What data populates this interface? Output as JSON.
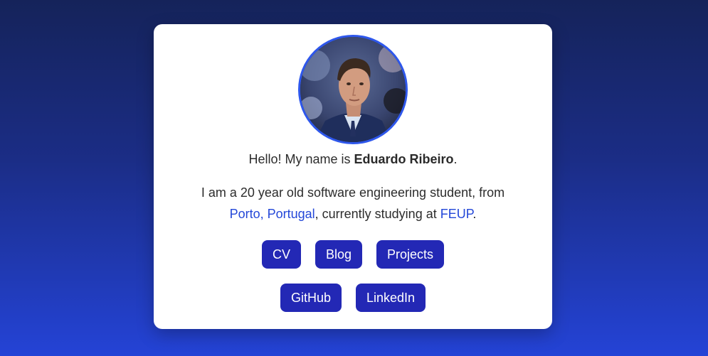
{
  "profile": {
    "greeting_prefix": "Hello! My name is ",
    "name": "Eduardo Ribeiro",
    "greeting_suffix": ".",
    "bio_prefix": "I am a 20 year old software engineering student, from",
    "location_link": "Porto, Portugal",
    "bio_middle": ", currently studying at ",
    "school_link": "FEUP",
    "bio_suffix": "."
  },
  "buttons_row1": [
    "CV",
    "Blog",
    "Projects"
  ],
  "buttons_row2": [
    "GitHub",
    "LinkedIn"
  ],
  "colors": {
    "accent": "#2328b5",
    "link": "#2347d8",
    "avatar_border": "#2e57ec",
    "background_top": "#15235a",
    "background_bottom": "#2443d6"
  }
}
